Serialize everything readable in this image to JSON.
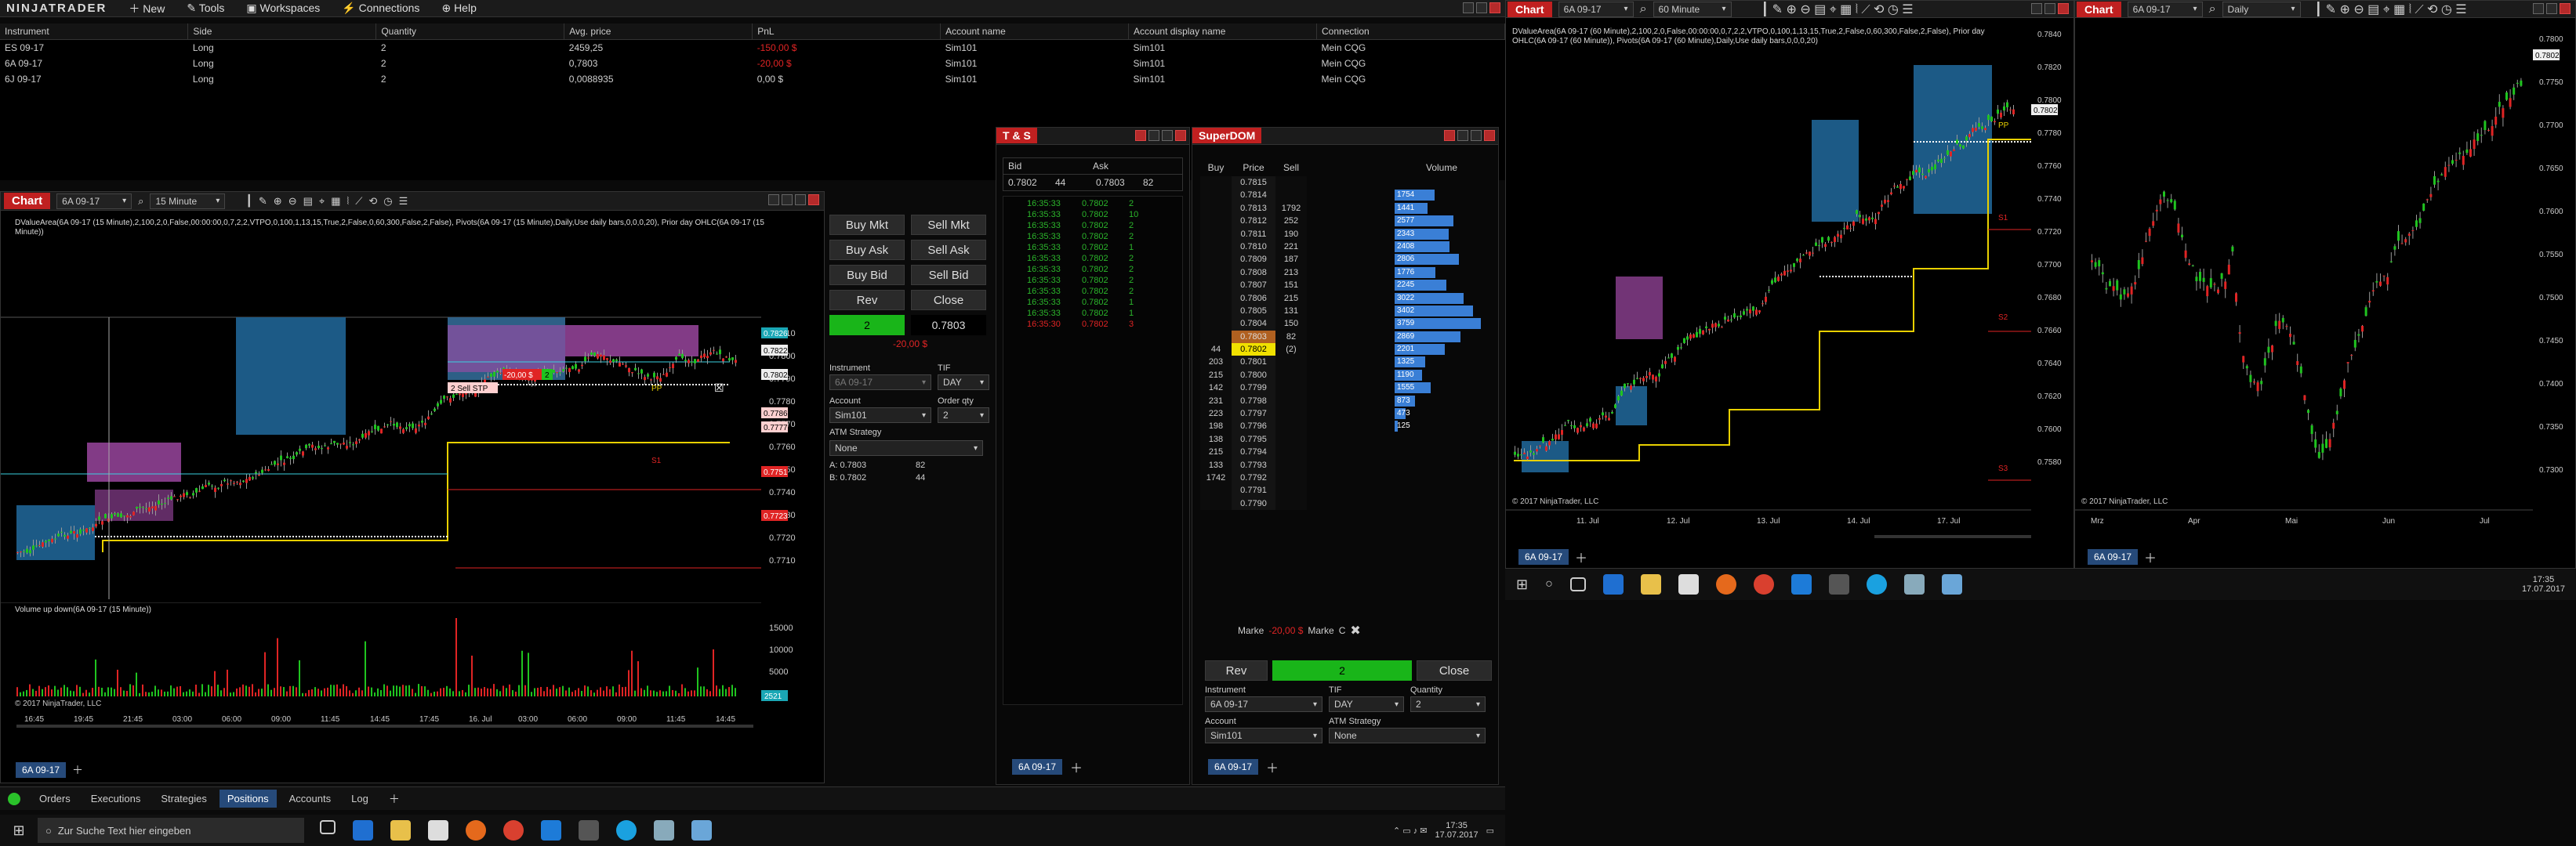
{
  "app": {
    "brand": "NINJATRADER",
    "menu": [
      "New",
      "Tools",
      "Workspaces",
      "Connections",
      "Help"
    ]
  },
  "positions": {
    "columns": [
      "Instrument",
      "Side",
      "Quantity",
      "Avg. price",
      "PnL",
      "Account name",
      "Account display name",
      "Connection"
    ],
    "rows": [
      [
        "ES 09-17",
        "Long",
        "2",
        "2459,25",
        "-150,00 $",
        "Sim101",
        "Sim101",
        "Mein CQG"
      ],
      [
        "6A 09-17",
        "Long",
        "2",
        "0,7803",
        "-20,00 $",
        "Sim101",
        "Sim101",
        "Mein CQG"
      ],
      [
        "6J 09-17",
        "Long",
        "2",
        "0,0088935",
        "0,00 $",
        "Sim101",
        "Sim101",
        "Mein CQG"
      ]
    ]
  },
  "chart1": {
    "tab": "Chart",
    "instrument": "6A 09-17",
    "interval": "15 Minute",
    "indicator_text": "DValueArea(6A 09-17 (15 Minute),2,100,2,0,False,00:00:00,0,7,2,2,VTPO,0,100,1,13,15,True,2,False,0,60,300,False,2,False), Pivots(6A 09-17 (15 Minute),Daily,Use daily bars,0,0,0,20), Prior day OHLC(6A 09-17 (15 Minute))",
    "y_ticks": [
      "0.7810",
      "0.7800",
      "0.7790",
      "0.7780",
      "0.7770",
      "0.7760",
      "0.7750",
      "0.7740",
      "0.7730",
      "0.7720",
      "0.7710"
    ],
    "price_tags": [
      {
        "v": "0.7826",
        "c": "#1aa7b5"
      },
      {
        "v": "0.7822",
        "c": "#eee"
      },
      {
        "v": "0.7802",
        "c": "#eee"
      },
      {
        "v": "0.7786",
        "c": "#ffd0d0"
      },
      {
        "v": "0.7777",
        "c": "#ffd0d0"
      },
      {
        "v": "0.7751",
        "c": "#e02424"
      },
      {
        "v": "0.7723",
        "c": "#e02424"
      }
    ],
    "order_label": "-20,00 $",
    "order_qty": "2",
    "stop_label": "2 Sell STP",
    "s1": "S1",
    "pp": "PP",
    "vol_title": "Volume up down(6A 09-17 (15 Minute))",
    "vol_ticks": [
      "15000",
      "10000",
      "5000"
    ],
    "vol_tag": "2521",
    "x_ticks": [
      "16:45",
      "19:45",
      "21:45",
      "03:00",
      "06:00",
      "09:00",
      "11:45",
      "14:45",
      "17:45",
      "16. Jul",
      "03:00",
      "06:00",
      "09:00",
      "11:45",
      "14:45"
    ],
    "copyright": "© 2017 NinjaTrader, LLC",
    "bottom_tab": "6A 09-17"
  },
  "order_panel": {
    "buy_mkt": "Buy Mkt",
    "sell_mkt": "Sell Mkt",
    "buy_ask": "Buy Ask",
    "sell_ask": "Sell Ask",
    "buy_bid": "Buy Bid",
    "sell_bid": "Sell Bid",
    "rev": "Rev",
    "close": "Close",
    "pos_qty": "2",
    "pos_price": "0.7803",
    "pnl": "-20,00 $",
    "instrument_label": "Instrument",
    "instrument": "6A 09-17",
    "tif_label": "TIF",
    "tif": "DAY",
    "account_label": "Account",
    "account": "Sim101",
    "qty_label": "Order qty",
    "qty": "2",
    "atm_label": "ATM Strategy",
    "atm": "None",
    "ask": "A:  0.7803",
    "ask_size": "82",
    "bid": "B:  0.7802",
    "bid_size": "44"
  },
  "bottom_tabs": [
    "Orders",
    "Executions",
    "Strategies",
    "Positions",
    "Accounts",
    "Log"
  ],
  "ts": {
    "title": "T & S",
    "bid_label": "Bid",
    "ask_label": "Ask",
    "bid": "0.7802",
    "bid_size": "44",
    "ask": "0.7803",
    "ask_size": "82",
    "rows": [
      [
        "16:35:33",
        "0.7802",
        "2",
        "g"
      ],
      [
        "16:35:33",
        "0.7802",
        "10",
        "g"
      ],
      [
        "16:35:33",
        "0.7802",
        "2",
        "g"
      ],
      [
        "16:35:33",
        "0.7802",
        "2",
        "g"
      ],
      [
        "16:35:33",
        "0.7802",
        "1",
        "g"
      ],
      [
        "16:35:33",
        "0.7802",
        "2",
        "g"
      ],
      [
        "16:35:33",
        "0.7802",
        "2",
        "g"
      ],
      [
        "16:35:33",
        "0.7802",
        "2",
        "g"
      ],
      [
        "16:35:33",
        "0.7802",
        "2",
        "g"
      ],
      [
        "16:35:33",
        "0.7802",
        "1",
        "g"
      ],
      [
        "16:35:33",
        "0.7802",
        "1",
        "g"
      ],
      [
        "16:35:30",
        "0.7802",
        "3",
        "r"
      ]
    ],
    "tab": "6A 09-17"
  },
  "superdom": {
    "title": "SuperDOM",
    "buy_label": "Buy",
    "price_label": "Price",
    "sell_label": "Sell",
    "volume_label": "Volume",
    "rows": [
      [
        "",
        "0.7815",
        "",
        ""
      ],
      [
        "",
        "0.7814",
        "",
        "1754"
      ],
      [
        "",
        "0.7813",
        "1792",
        "1441"
      ],
      [
        "",
        "0.7812",
        "252",
        "2577"
      ],
      [
        "",
        "0.7811",
        "190",
        "2343"
      ],
      [
        "",
        "0.7810",
        "221",
        "2408"
      ],
      [
        "",
        "0.7809",
        "187",
        "2806"
      ],
      [
        "",
        "0.7808",
        "213",
        "1776"
      ],
      [
        "",
        "0.7807",
        "151",
        "2245"
      ],
      [
        "",
        "0.7806",
        "215",
        "3022"
      ],
      [
        "",
        "0.7805",
        "131",
        "3402"
      ],
      [
        "",
        "0.7804",
        "150",
        "3759"
      ],
      [
        "",
        "0.7803",
        "82",
        "2869"
      ],
      [
        "44",
        "0.7802",
        "(2)",
        "2201"
      ],
      [
        "203",
        "0.7801",
        "",
        "1325"
      ],
      [
        "215",
        "0.7800",
        "",
        "1190"
      ],
      [
        "142",
        "0.7799",
        "",
        "1555"
      ],
      [
        "231",
        "0.7798",
        "",
        "873"
      ],
      [
        "223",
        "0.7797",
        "",
        "473"
      ],
      [
        "198",
        "0.7796",
        "",
        "125"
      ],
      [
        "138",
        "0.7795",
        "",
        ""
      ],
      [
        "215",
        "0.7794",
        "",
        ""
      ],
      [
        "133",
        "0.7793",
        "",
        ""
      ],
      [
        "1742",
        "0.7792",
        "",
        ""
      ],
      [
        "",
        "0.7791",
        "",
        ""
      ],
      [
        "",
        "0.7790",
        "",
        ""
      ]
    ],
    "vol_values": [
      1754,
      1441,
      2577,
      2343,
      2408,
      2806,
      1776,
      2245,
      3022,
      3402,
      3759,
      2869,
      2201,
      1325,
      1190,
      1555,
      873,
      473,
      125
    ],
    "market_l": "Marke",
    "pnl": "-20,00 $",
    "market_r": "Marke",
    "c": "C",
    "rev": "Rev",
    "pos_qty": "2",
    "close": "Close",
    "instrument_label": "Instrument",
    "instrument": "6A 09-17",
    "tif_label": "TIF",
    "tif": "DAY",
    "qty_label": "Quantity",
    "qty": "2",
    "account_label": "Account",
    "account": "Sim101",
    "atm_label": "ATM Strategy",
    "atm": "None",
    "tab": "6A 09-17"
  },
  "chart2": {
    "tab": "Chart",
    "instrument": "6A 09-17",
    "interval": "60 Minute",
    "indicator_text": "DValueArea(6A 09-17 (60 Minute),2,100,2,0,False,00:00:00,0,7,2,2,VTPO,0,100,1,13,15,True,2,False,0,60,300,False,2,False), Prior day OHLC(6A 09-17 (60 Minute)), Pivots(6A 09-17 (60 Minute),Daily,Use daily bars,0,0,0,20)",
    "y_ticks": [
      "0.7840",
      "0.7820",
      "0.7800",
      "0.7780",
      "0.7760",
      "0.7740",
      "0.7720",
      "0.7700",
      "0.7680",
      "0.7660",
      "0.7640",
      "0.7620",
      "0.7600",
      "0.7580"
    ],
    "price_tag": "0.7802",
    "x_ticks": [
      "11. Jul",
      "12. Jul",
      "13. Jul",
      "14. Jul",
      "17. Jul"
    ],
    "labels": {
      "pp": "PP",
      "s1": "S1",
      "s2": "S2",
      "s3": "S3"
    },
    "copyright": "© 2017 NinjaTrader, LLC",
    "bottom_tab": "6A 09-17"
  },
  "chart3": {
    "tab": "Chart",
    "instrument": "6A 09-17",
    "interval": "Daily",
    "y_ticks": [
      "0.7800",
      "0.7750",
      "0.7700",
      "0.7650",
      "0.7600",
      "0.7550",
      "0.7500",
      "0.7450",
      "0.7400",
      "0.7350",
      "0.7300"
    ],
    "price_tag": "0.7802",
    "x_ticks": [
      "Mrz",
      "Apr",
      "Mai",
      "Jun",
      "Jul"
    ],
    "copyright": "© 2017 NinjaTrader, LLC",
    "bottom_tab": "6A 09-17"
  },
  "taskbar": {
    "search": "Zur Suche Text hier eingeben",
    "time": "17:35",
    "date": "17.07.2017"
  },
  "taskbar2": {
    "time": "17:35",
    "date": "17.07.2017"
  }
}
